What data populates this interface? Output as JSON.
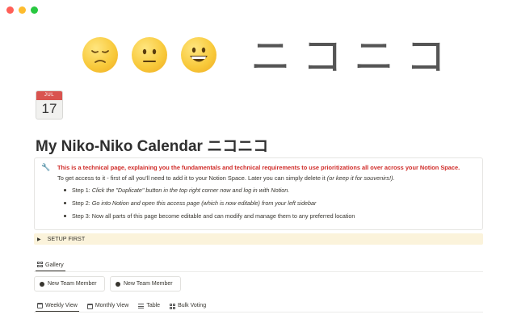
{
  "cover": {
    "kana": "ニコニコ",
    "faces": [
      "sad-face",
      "neutral-face",
      "grinning-face"
    ]
  },
  "page_icon": {
    "month": "JUL",
    "day": "17"
  },
  "title": {
    "text": "My Niko-Niko Calendar",
    "kana": "ニコニコ"
  },
  "callout": {
    "icon": "wrench-icon",
    "headline": "This is a technical page, explaining you the fundamentals and technical requirements to use prioritizations all over across your Notion Space.",
    "line1": "To get access to it - first of all you'll need to add it to your Notion Space. Later you can simply delete it",
    "line1_em": "(or keep it for souvenirs!).",
    "steps": [
      {
        "label": "Step 1:",
        "text": "Click the \"Duplicate\" button in the top right corner now and log in with Notion."
      },
      {
        "label": "Step 2:",
        "text": "Go into Notion and open this access page (which is now editable) from your left sidebar"
      },
      {
        "label": "Step 3:",
        "text": "Now all parts of this page become editable and can modify and manage them to any preferred location"
      }
    ]
  },
  "toggle": {
    "label": "SETUP FIRST"
  },
  "gallery_tab": {
    "label": "Gallery"
  },
  "cards": [
    "New Team Member",
    "New Team Member"
  ],
  "views": [
    "Weekly View",
    "Monthly View",
    "Table",
    "Bulk Voting"
  ]
}
